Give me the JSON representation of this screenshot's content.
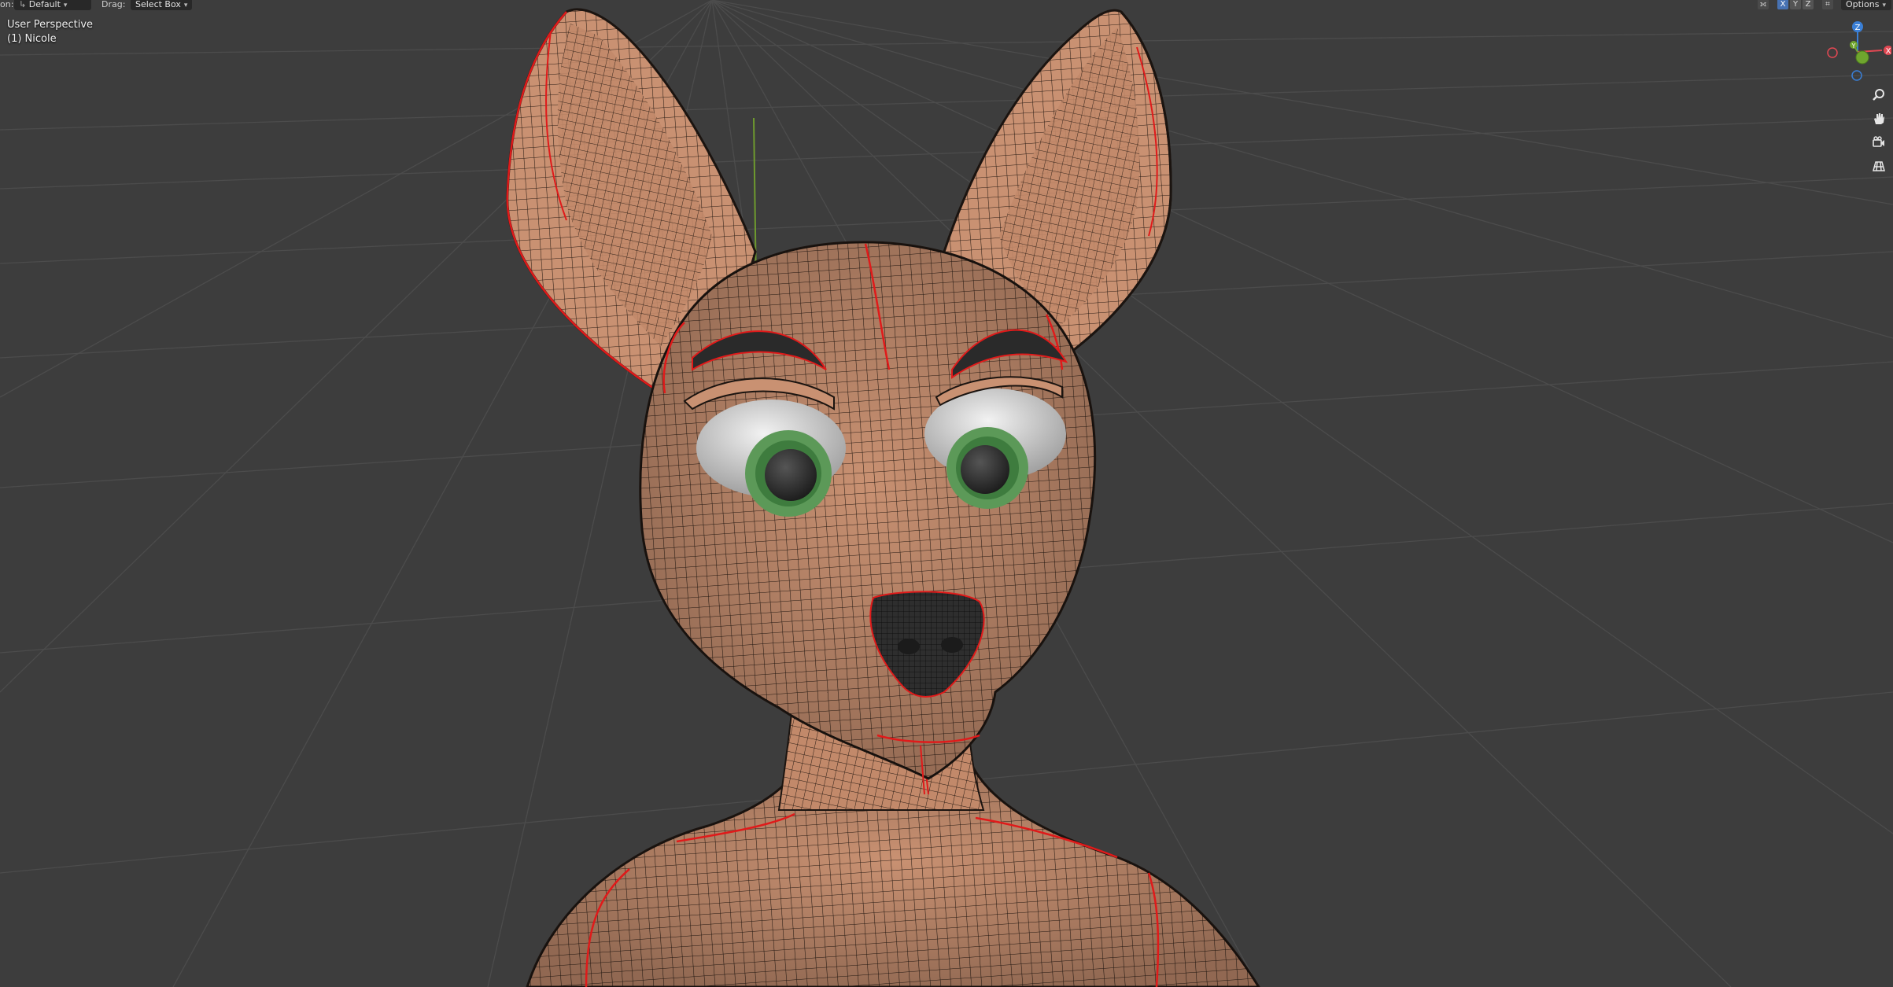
{
  "header": {
    "orientation_label": "on:",
    "orientation_value": "Default",
    "drag_label": "Drag:",
    "drag_value": "Select Box",
    "axes": [
      {
        "label": "X",
        "active": true
      },
      {
        "label": "Y",
        "active": false
      },
      {
        "label": "Z",
        "active": false
      }
    ],
    "options_label": "Options"
  },
  "viewport": {
    "view_name": "User Perspective",
    "object_name": "(1) Nicole"
  },
  "gizmo": {
    "z_label": "Z",
    "y_label": "Y",
    "x_label": "X",
    "colors": {
      "x": "#e34853",
      "y": "#6fa52e",
      "z": "#3a7fd6"
    }
  },
  "nav_icons": [
    "zoom-icon",
    "pan-hand-icon",
    "camera-view-icon",
    "grid-ortho-icon"
  ],
  "colors": {
    "background": "#3d3d3d",
    "skin": "#c99172",
    "wire": "#1b1410",
    "seam": "#e01a1a",
    "iris": "#5c9958"
  }
}
